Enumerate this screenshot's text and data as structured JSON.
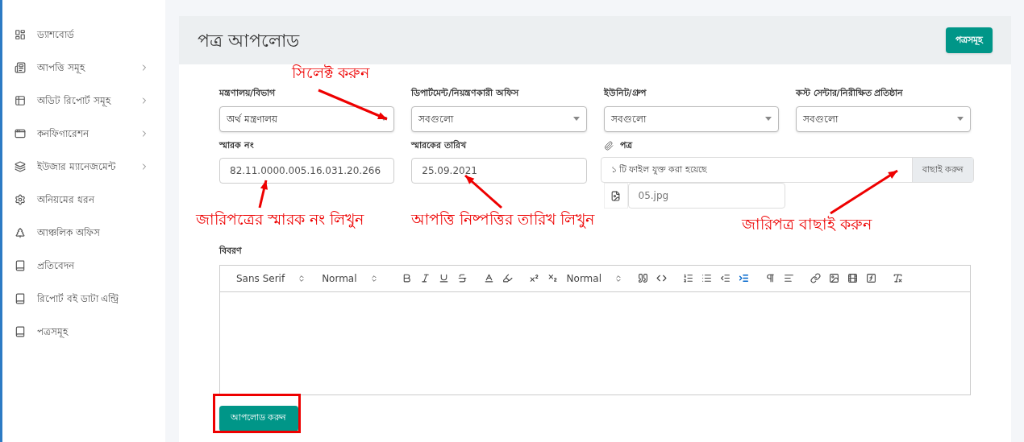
{
  "sidebar": {
    "items": [
      {
        "label": "ড্যাশবোর্ড",
        "has_submenu": false
      },
      {
        "label": "আপত্তি সমূহ",
        "has_submenu": true
      },
      {
        "label": "অডিট রিপোর্ট সমূহ",
        "has_submenu": true
      },
      {
        "label": "কনফিগারেশন",
        "has_submenu": true
      },
      {
        "label": "ইউজার ম্যানেজমেন্ট",
        "has_submenu": true
      },
      {
        "label": "অনিয়মের ধরন",
        "has_submenu": false
      },
      {
        "label": "আঞ্চলিক অফিস",
        "has_submenu": false
      },
      {
        "label": "প্রতিবেদন",
        "has_submenu": false
      },
      {
        "label": "রিপোর্ট বই ডাটা এন্ট্রি",
        "has_submenu": false
      },
      {
        "label": "পত্রসমূহ",
        "has_submenu": false
      }
    ]
  },
  "page": {
    "title": "পত্র আপলোড",
    "header_button": "পত্রসমূহ"
  },
  "filters": [
    {
      "label": "মন্ত্রণালয়/বিভাগ",
      "value": "অর্থ মন্ত্রণালয়"
    },
    {
      "label": "ডিপার্টমেন্ট/নিয়ন্ত্রণকারী অফিস",
      "value": "সবগুলো"
    },
    {
      "label": "ইউনিট/গ্রুপ",
      "value": "সবগুলো"
    },
    {
      "label": "কস্ট সেন্টার/নিরীক্ষিত প্রতিষ্ঠান",
      "value": "সবগুলো"
    }
  ],
  "memo_no": {
    "label": "স্মারক নং",
    "value": "82.11.0000.005.16.031.20.266"
  },
  "memo_date": {
    "label": "স্মারকের তারিখ",
    "value": "25.09.2021"
  },
  "attachment": {
    "label": "পত্র",
    "status": "১ টি ফাইল যুক্ত করা হয়েছে",
    "button": "বাছাই করুন",
    "files": [
      "05.jpg"
    ]
  },
  "description": {
    "label": "বিবরণ",
    "toolbar": [
      {
        "kind": "select",
        "text": "Sans Serif"
      },
      {
        "kind": "select",
        "text": "Normal"
      },
      {
        "kind": "bold",
        "active": false
      },
      {
        "kind": "italic",
        "active": false
      },
      {
        "kind": "underline",
        "active": false
      },
      {
        "kind": "strike",
        "active": false
      },
      {
        "kind": "color",
        "active": false
      },
      {
        "kind": "background",
        "active": false
      },
      {
        "kind": "superscript",
        "active": false
      },
      {
        "kind": "subscript",
        "active": false
      },
      {
        "kind": "select",
        "text": "Normal"
      },
      {
        "kind": "quote",
        "active": false
      },
      {
        "kind": "code",
        "active": false
      },
      {
        "kind": "ordered-list",
        "active": false
      },
      {
        "kind": "bullet-list",
        "active": false
      },
      {
        "kind": "outdent",
        "active": false
      },
      {
        "kind": "indent",
        "active": true
      },
      {
        "kind": "direction",
        "active": false
      },
      {
        "kind": "align",
        "active": false
      },
      {
        "kind": "link",
        "active": false
      },
      {
        "kind": "image",
        "active": false
      },
      {
        "kind": "video",
        "active": false
      },
      {
        "kind": "formula",
        "active": false
      },
      {
        "kind": "clean",
        "active": false
      }
    ]
  },
  "submit_button": "আপলোড করুন",
  "annotations": [
    {
      "text": "সিলেক্ট করুন"
    },
    {
      "text": "জারিপত্রের স্মারক নং লিখুন"
    },
    {
      "text": "আপত্তি নিষ্পত্তির তারিখ লিখুন"
    },
    {
      "text": "জারিপত্র বাছাই করুন"
    }
  ]
}
